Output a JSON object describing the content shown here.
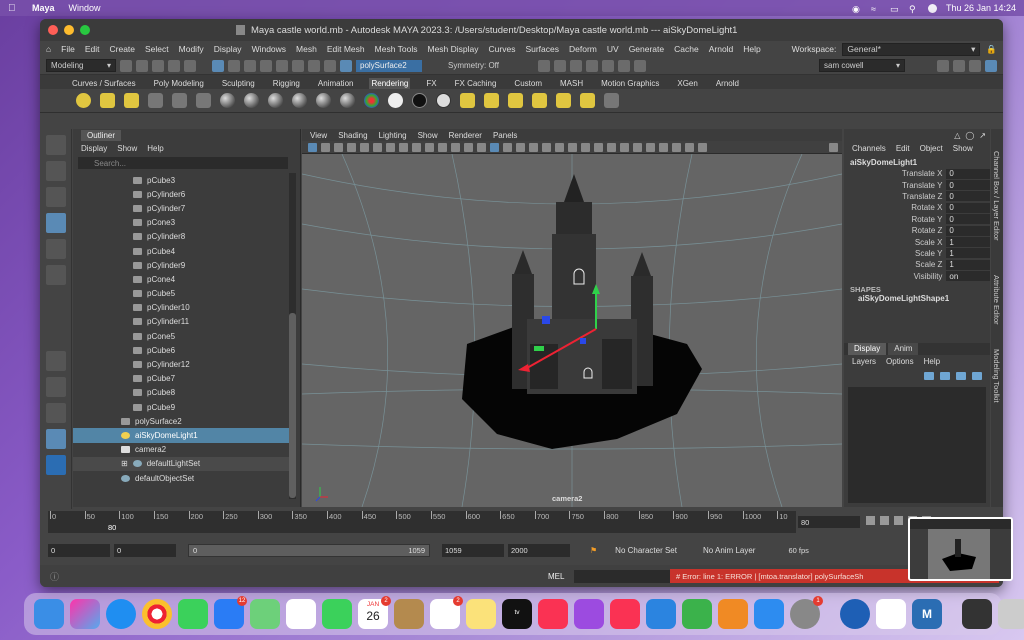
{
  "mac_menubar": {
    "app": "Maya",
    "menu": "Window",
    "clock": "Thu 26 Jan  14:24"
  },
  "window": {
    "title": "Maya castle world.mb - Autodesk MAYA 2023.3: /Users/student/Desktop/Maya castle world.mb   ---   aiSkyDomeLight1"
  },
  "menus": [
    "File",
    "Edit",
    "Create",
    "Select",
    "Modify",
    "Display",
    "Windows",
    "Mesh",
    "Edit Mesh",
    "Mesh Tools",
    "Mesh Display",
    "Curves",
    "Surfaces",
    "Deform",
    "UV",
    "Generate",
    "Cache",
    "Arnold",
    "Help"
  ],
  "workspace": {
    "label": "Workspace:",
    "value": "General*"
  },
  "statusline": {
    "mode": "Modeling",
    "selection_field": "polySurface2",
    "symmetry": "Symmetry: Off",
    "user": "sam cowell"
  },
  "shelf_tabs": [
    "Curves / Surfaces",
    "Poly Modeling",
    "Sculpting",
    "Rigging",
    "Animation",
    "Rendering",
    "FX",
    "FX Caching",
    "Custom",
    "MASH",
    "Motion Graphics",
    "XGen",
    "Arnold"
  ],
  "shelf_active": "Rendering",
  "outliner": {
    "tab": "Outliner",
    "menu": [
      "Display",
      "Show",
      "Help"
    ],
    "search_placeholder": "Search...",
    "items": [
      {
        "label": "pCube3"
      },
      {
        "label": "pCylinder6"
      },
      {
        "label": "pCylinder7"
      },
      {
        "label": "pCone3"
      },
      {
        "label": "pCylinder8"
      },
      {
        "label": "pCube4"
      },
      {
        "label": "pCylinder9"
      },
      {
        "label": "pCone4"
      },
      {
        "label": "pCube5"
      },
      {
        "label": "pCylinder10"
      },
      {
        "label": "pCylinder11"
      },
      {
        "label": "pCone5"
      },
      {
        "label": "pCube6"
      },
      {
        "label": "pCylinder12"
      },
      {
        "label": "pCube7"
      },
      {
        "label": "pCube8"
      },
      {
        "label": "pCube9"
      },
      {
        "label": "polySurface2"
      },
      {
        "label": "aiSkyDomeLight1"
      },
      {
        "label": "camera2"
      },
      {
        "label": "defaultLightSet"
      },
      {
        "label": "defaultObjectSet"
      }
    ],
    "selected": "aiSkyDomeLight1"
  },
  "viewport": {
    "menu": [
      "View",
      "Shading",
      "Lighting",
      "Show",
      "Renderer",
      "Panels"
    ],
    "camera_label": "camera2"
  },
  "channel_box": {
    "menu": [
      "Channels",
      "Edit",
      "Object",
      "Show"
    ],
    "object": "aiSkyDomeLight1",
    "attributes": [
      {
        "name": "Translate X",
        "value": "0"
      },
      {
        "name": "Translate Y",
        "value": "0"
      },
      {
        "name": "Translate Z",
        "value": "0"
      },
      {
        "name": "Rotate X",
        "value": "0"
      },
      {
        "name": "Rotate Y",
        "value": "0"
      },
      {
        "name": "Rotate Z",
        "value": "0"
      },
      {
        "name": "Scale X",
        "value": "1"
      },
      {
        "name": "Scale Y",
        "value": "1"
      },
      {
        "name": "Scale Z",
        "value": "1"
      },
      {
        "name": "Visibility",
        "value": "on"
      }
    ],
    "shapes_header": "SHAPES",
    "shape_name": "aiSkyDomeLightShape1",
    "layer_tabs": [
      "Display",
      "Anim"
    ],
    "layer_menu": [
      "Layers",
      "Options",
      "Help"
    ]
  },
  "side_tabs": [
    "Channel Box / Layer Editor",
    "Attribute Editor",
    "Modeling Toolkit"
  ],
  "timeline": {
    "ticks": [
      "0",
      "50",
      "100",
      "150",
      "200",
      "250",
      "300",
      "350",
      "400",
      "450",
      "500",
      "550",
      "600",
      "650",
      "700",
      "750",
      "800",
      "850",
      "900",
      "950",
      "1000",
      "10"
    ],
    "current_frame": "80",
    "current_field": "80"
  },
  "range": {
    "start": "0",
    "anim_start": "0",
    "range_start": "0",
    "range_end": "1059",
    "anim_end": "1059",
    "end": "2000",
    "character_set": "No Character Set",
    "anim_layer": "No Anim Layer",
    "fps": "60 fps"
  },
  "command_line": {
    "mode": "MEL",
    "error": "# Error: line 1: ERROR   |    [mtoa.translator]  polySurfaceSh"
  },
  "dock": {
    "calendar_month": "JAN",
    "calendar_day": "26",
    "badges": {
      "mail": "12",
      "calendar": "2",
      "reminders": "2",
      "settings": "1"
    },
    "tv_label": "tv",
    "maya_label": "M"
  },
  "colors": {
    "maya_panel": "#444444",
    "selection_blue": "#5285a6",
    "error_red": "#c8332b",
    "scene_grey": "#656565"
  }
}
